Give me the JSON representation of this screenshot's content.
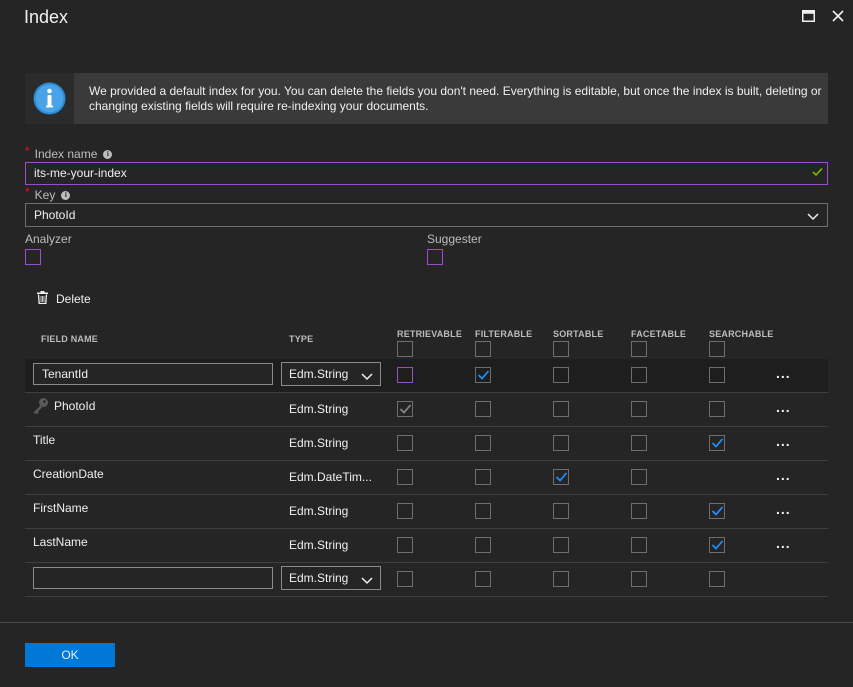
{
  "title": "Index",
  "info_text": "We provided a default index for you. You can delete the fields you don't need. Everything is editable, but once the index is built, deleting or changing existing fields will require re-indexing your documents.",
  "index_name_label": "Index name",
  "index_name_value": "its-me-your-index",
  "key_label": "Key",
  "key_value": "PhotoId",
  "analyzer_label": "Analyzer",
  "suggester_label": "Suggester",
  "delete_label": "Delete",
  "columns": {
    "field_name": "FIELD NAME",
    "type": "TYPE",
    "retrievable": "RETRIEVABLE",
    "filterable": "FILTERABLE",
    "sortable": "SORTABLE",
    "facetable": "FACETABLE",
    "searchable": "SEARCHABLE"
  },
  "rows": [
    {
      "name": "TenantId",
      "type": "Edm.String",
      "editable": true,
      "key": false,
      "retrievable": false,
      "filterable": true,
      "sortable": false,
      "facetable": false,
      "searchable": false,
      "has_searchable": true,
      "more": "..."
    },
    {
      "name": "PhotoId",
      "type": "Edm.String",
      "editable": false,
      "key": true,
      "retrievable": true,
      "filterable": false,
      "sortable": false,
      "facetable": false,
      "searchable": false,
      "has_searchable": true,
      "more": "..."
    },
    {
      "name": "Title",
      "type": "Edm.String",
      "editable": false,
      "key": false,
      "retrievable": false,
      "filterable": false,
      "sortable": false,
      "facetable": false,
      "searchable": true,
      "has_searchable": true,
      "more": "..."
    },
    {
      "name": "CreationDate",
      "type": "Edm.DateTim...",
      "editable": false,
      "key": false,
      "retrievable": false,
      "filterable": false,
      "sortable": true,
      "facetable": false,
      "searchable": false,
      "has_searchable": false,
      "more": "..."
    },
    {
      "name": "FirstName",
      "type": "Edm.String",
      "editable": false,
      "key": false,
      "retrievable": false,
      "filterable": false,
      "sortable": false,
      "facetable": false,
      "searchable": true,
      "has_searchable": true,
      "more": "..."
    },
    {
      "name": "LastName",
      "type": "Edm.String",
      "editable": false,
      "key": false,
      "retrievable": false,
      "filterable": false,
      "sortable": false,
      "facetable": false,
      "searchable": true,
      "has_searchable": true,
      "more": "..."
    }
  ],
  "new_row": {
    "name": "",
    "type": "Edm.String"
  },
  "ok_label": "OK",
  "colors": {
    "accent": "#0078d7",
    "focus": "#9b4dca",
    "valid": "#7fba00"
  }
}
